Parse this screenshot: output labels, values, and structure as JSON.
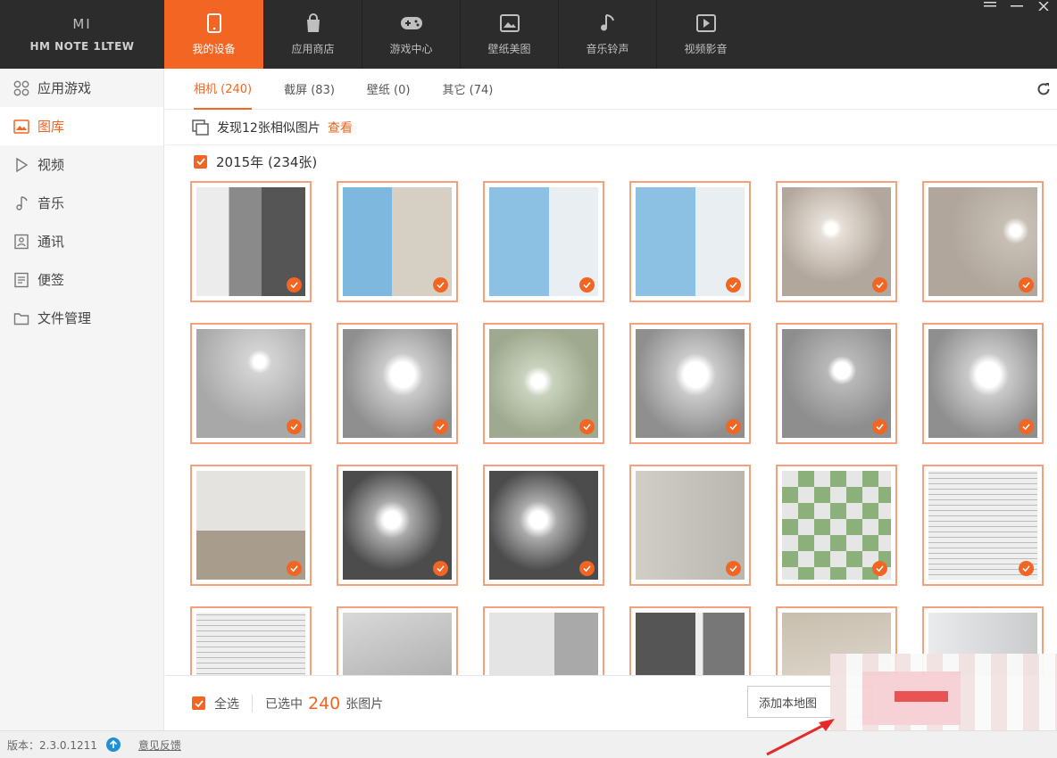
{
  "device": {
    "logo": "MI",
    "name": "HM NOTE 1LTEW"
  },
  "nav": [
    {
      "label": "我的设备",
      "icon": "phone-icon",
      "active": true
    },
    {
      "label": "应用商店",
      "icon": "bag-icon"
    },
    {
      "label": "游戏中心",
      "icon": "gamepad-icon"
    },
    {
      "label": "壁纸美图",
      "icon": "wallpaper-icon"
    },
    {
      "label": "音乐铃声",
      "icon": "music-note-icon"
    },
    {
      "label": "视频影音",
      "icon": "play-icon"
    }
  ],
  "sidebar": [
    {
      "label": "应用游戏",
      "icon": "apps-icon"
    },
    {
      "label": "图库",
      "icon": "image-icon",
      "active": true
    },
    {
      "label": "视频",
      "icon": "play-icon"
    },
    {
      "label": "音乐",
      "icon": "music-note-icon"
    },
    {
      "label": "通讯",
      "icon": "contacts-icon"
    },
    {
      "label": "便签",
      "icon": "note-icon"
    },
    {
      "label": "文件管理",
      "icon": "folder-icon"
    }
  ],
  "subtabs": [
    {
      "label": "相机 (240)",
      "active": true
    },
    {
      "label": "截屏 (83)"
    },
    {
      "label": "壁纸 (0)"
    },
    {
      "label": "其它 (74)"
    }
  ],
  "similar": {
    "text": "发现12张相似图片",
    "link": "查看"
  },
  "group": {
    "label": "2015年 (234张)"
  },
  "actionbar": {
    "select_all": "全选",
    "selected_prefix": "已选中",
    "selected_count": "240",
    "selected_suffix": "张图片",
    "add_button": "添加本地图"
  },
  "status": {
    "version": "版本：2.3.0.1211",
    "feedback": "意见反馈"
  },
  "colors": {
    "accent": "#f26522",
    "topbar": "#2c2c2c"
  },
  "photos": [
    "hallway",
    "beach",
    "sea",
    "sea",
    "lamp-warm",
    "lamp-warm-multi",
    "lamp-grey",
    "lamp-ceiling",
    "lamp-green",
    "lamp-ceiling",
    "chandelier",
    "lamp-ceiling",
    "room",
    "crystal-lamp",
    "crystal-lamp",
    "wall",
    "checker",
    "paper",
    "paper",
    "ceiling",
    "door",
    "door-dark",
    "cloth",
    "wall-light"
  ]
}
